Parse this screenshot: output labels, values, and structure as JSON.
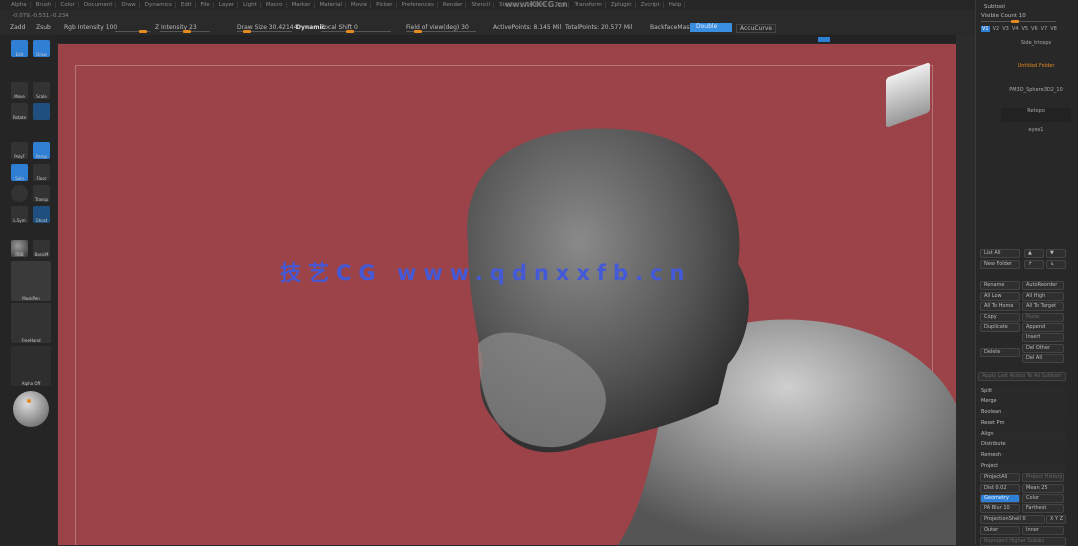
{
  "menu": [
    "Alpha",
    "Brush",
    "Color",
    "Document",
    "Draw",
    "Dynamics",
    "Edit",
    "File",
    "Layer",
    "Light",
    "Macro",
    "Marker",
    "Material",
    "Movie",
    "Picker",
    "Preferences",
    "Render",
    "Stencil",
    "Stroke",
    "Texture",
    "Tool",
    "Transform",
    "Zplugin",
    "Zscript",
    "Help"
  ],
  "top_watermark": "www.KKCG.cn",
  "coords": "-0.079,-0.531,-0.234",
  "toolbar": {
    "zadd": "Zadd",
    "zsub": "Zsub",
    "rgb_intensity": "Rgb Intensity 100",
    "z_intensity": "Z Intensity 23",
    "draw_size": "Draw Size 30.42144",
    "dynamic": "Dynamic",
    "focal_shift": "Focal Shift 0",
    "fov": "Field of view(deg) 30",
    "active_points": "ActivePoints: 8.145 Mil",
    "total_points": "TotalPoints: 20.577 Mil",
    "backface_mask": "BackfaceMask",
    "double": "Double",
    "accucurve": "AccuCurve"
  },
  "sliders": {
    "rgb_intensity": 100,
    "z_intensity": 23,
    "focal_shift": 0,
    "fov": 30
  },
  "left": {
    "edit": "Edit",
    "draw": "Draw",
    "move": "Move",
    "scale": "Scale",
    "rotate": "Rotate",
    "polyf": "PolyF",
    "persp": "Persp",
    "solo": "Solo",
    "floor": "Floor",
    "transp": "Transp",
    "lsym": "L.Sym",
    "ghost": "Ghost",
    "dynamic": "Dynamic",
    "mat1": "RBB",
    "mat2": "BasicM",
    "brush": "MaskPen",
    "stroke": "FreeHand",
    "alpha": "Alpha Off"
  },
  "canvas": {
    "bg": "#9b4348",
    "watermark": "技艺CG  www.qdnxxfb.cn"
  },
  "subtool": {
    "title": "Subtool",
    "visible_count": "Visible Count 10",
    "versions": [
      "V1",
      "V2",
      "V3",
      "V4",
      "V5",
      "V6",
      "V7",
      "V8"
    ],
    "items": [
      "Side_triceps",
      "Untitled Folder",
      "PM3D_Sphere3D2_10",
      "Retopo",
      "eyes1"
    ],
    "buttons": {
      "list_all": "List All",
      "new_folder": "New Folder",
      "rename": "Rename",
      "autoreorder": "AutoReorder",
      "all_low": "All Low",
      "all_high": "All High",
      "all_to_home": "All To Home",
      "all_to_target": "All To Target",
      "copy": "Copy",
      "paste": "Paste",
      "duplicate": "Duplicate",
      "append": "Append",
      "insert": "Insert",
      "delete": "Delete",
      "del_other": "Del Other",
      "del_all": "Del All",
      "apply_last": "Apply Last Action To All Subtool",
      "split": "Split",
      "merge": "Merge",
      "boolean": "Boolean",
      "remesh_pm": "Reset Pm",
      "align": "Align",
      "distribute": "Distribute",
      "remesh": "Remesh",
      "project": "Project",
      "project_all": "ProjectAll",
      "project_history": "Project History",
      "dist": "Dist 0.02",
      "mean": "Mean 25",
      "geometry": "Geometry",
      "color": "Color",
      "pa_blur": "PA Blur 10",
      "farthest": "Farthest",
      "projection_shell": "ProjectionShell 0",
      "xyz": "X Y Z",
      "outer": "Outer",
      "inner": "Inner",
      "reproject": "Reproject Higher Subdiv"
    }
  }
}
